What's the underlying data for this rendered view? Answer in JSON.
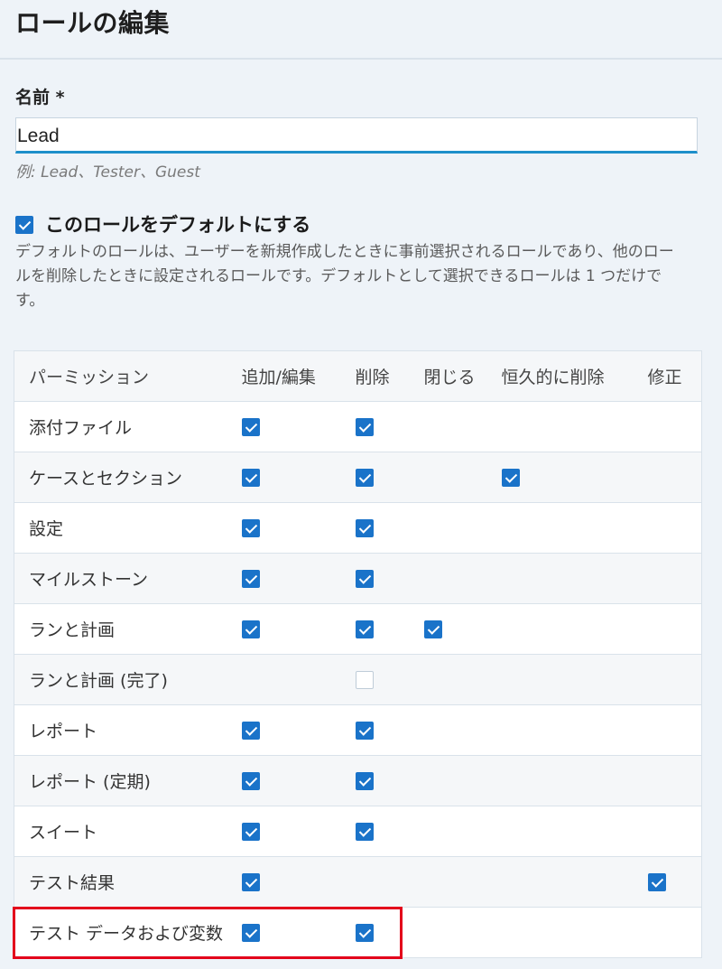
{
  "dialog": {
    "title": "ロールの編集"
  },
  "form": {
    "name_label": "名前 *",
    "name_value": "Lead",
    "name_hint": "例: Lead、Tester、Guest",
    "default_checked": true,
    "default_label": "このロールをデフォルトにする",
    "default_description": "デフォルトのロールは、ユーザーを新規作成したときに事前選択されるロールであり、他のロールを削除したときに設定されるロールです。デフォルトとして選択できるロールは 1 つだけです。"
  },
  "table": {
    "headers": [
      "パーミッション",
      "追加/編集",
      "削除",
      "閉じる",
      "恒久的に削除",
      "修正"
    ],
    "rows": [
      {
        "name": "添付ファイル",
        "add_edit": true,
        "delete": true,
        "close": null,
        "perm_delete": null,
        "fix": null
      },
      {
        "name": "ケースとセクション",
        "add_edit": true,
        "delete": true,
        "close": null,
        "perm_delete": true,
        "fix": null
      },
      {
        "name": "設定",
        "add_edit": true,
        "delete": true,
        "close": null,
        "perm_delete": null,
        "fix": null
      },
      {
        "name": "マイルストーン",
        "add_edit": true,
        "delete": true,
        "close": null,
        "perm_delete": null,
        "fix": null
      },
      {
        "name": "ランと計画",
        "add_edit": true,
        "delete": true,
        "close": true,
        "perm_delete": null,
        "fix": null
      },
      {
        "name": "ランと計画 (完了)",
        "add_edit": null,
        "delete": false,
        "close": null,
        "perm_delete": null,
        "fix": null
      },
      {
        "name": "レポート",
        "add_edit": true,
        "delete": true,
        "close": null,
        "perm_delete": null,
        "fix": null
      },
      {
        "name": "レポート (定期)",
        "add_edit": true,
        "delete": true,
        "close": null,
        "perm_delete": null,
        "fix": null
      },
      {
        "name": "スイート",
        "add_edit": true,
        "delete": true,
        "close": null,
        "perm_delete": null,
        "fix": null
      },
      {
        "name": "テスト結果",
        "add_edit": true,
        "delete": null,
        "close": null,
        "perm_delete": null,
        "fix": true
      },
      {
        "name": "テスト データおよび変数",
        "add_edit": true,
        "delete": true,
        "close": null,
        "perm_delete": null,
        "fix": null
      }
    ]
  },
  "colors": {
    "checkbox_on": "#1a73c9",
    "input_focus": "#1d8fca",
    "highlight": "#e3001b"
  }
}
